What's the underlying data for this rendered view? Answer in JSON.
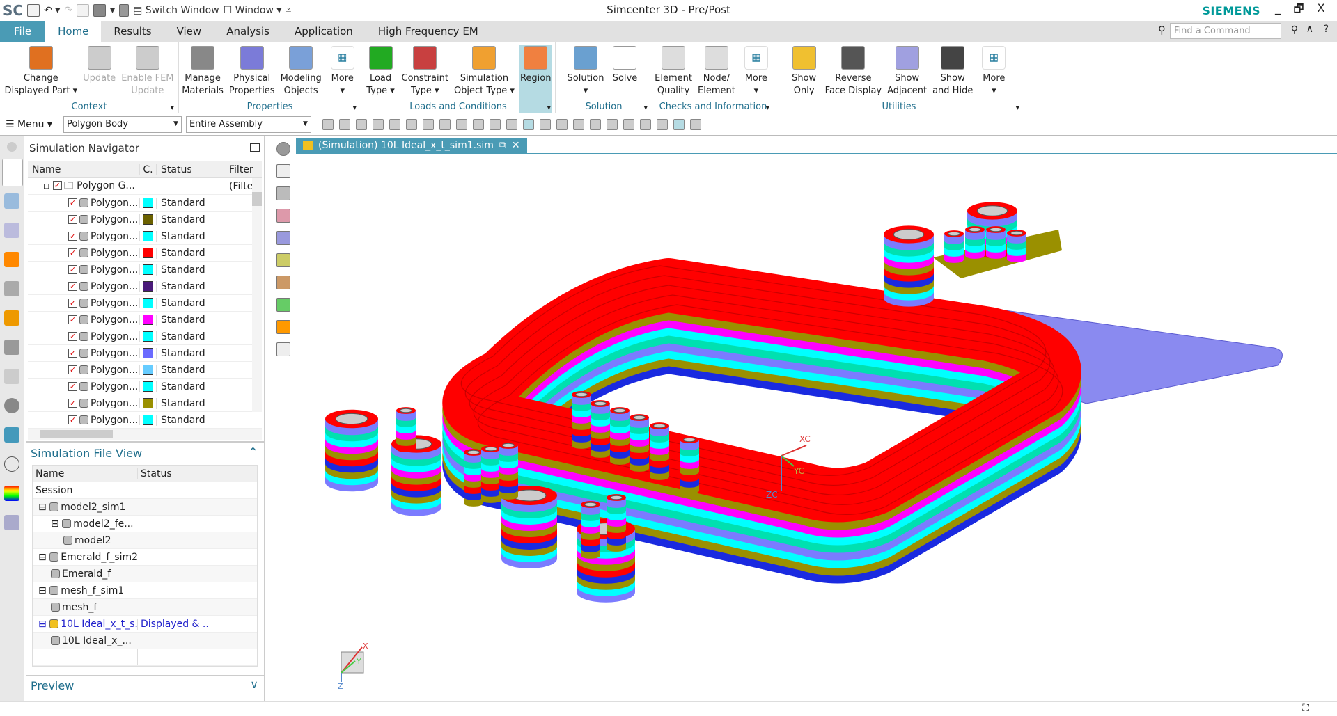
{
  "app": {
    "logo": "SC",
    "title": "Simcenter 3D - Pre/Post",
    "brand": "SIEMENS",
    "accent": "#4a9bb5"
  },
  "qat": {
    "switch_window": "Switch Window",
    "window": "Window"
  },
  "window_controls": {
    "minimize": "_",
    "restore": "🗗",
    "close": "X"
  },
  "tabs": [
    "File",
    "Home",
    "Results",
    "View",
    "Analysis",
    "Application",
    "High Frequency EM"
  ],
  "active_tab": "Home",
  "search": {
    "placeholder": "Find a Command"
  },
  "ribbon": [
    {
      "label": "Context",
      "w": 257,
      "buttons": [
        {
          "l1": "Change",
          "l2": "Displayed Part ▾",
          "icon": "change-displayed-part",
          "color": "#e07020"
        },
        {
          "l1": "Update",
          "l2": "",
          "icon": "update",
          "dis": true,
          "color": "#ccc"
        },
        {
          "l1": "Enable FEM",
          "l2": "Update",
          "icon": "enable-fem-update",
          "dis": true,
          "color": "#ccc"
        }
      ]
    },
    {
      "label": "Properties",
      "w": 262,
      "buttons": [
        {
          "l1": "Manage",
          "l2": "Materials",
          "icon": "manage-materials",
          "color": "#888"
        },
        {
          "l1": "Physical",
          "l2": "Properties",
          "icon": "physical-properties",
          "color": "#7b7bd8"
        },
        {
          "l1": "Modeling",
          "l2": "Objects",
          "icon": "modeling-objects",
          "color": "#7aa0d8"
        },
        {
          "l1": "More",
          "l2": "▾",
          "icon": "more",
          "more": true
        }
      ]
    },
    {
      "label": "Loads and Conditions",
      "w": 279,
      "buttons": [
        {
          "l1": "Load",
          "l2": "Type ▾",
          "icon": "load-type",
          "color": "#22aa22"
        },
        {
          "l1": "Constraint",
          "l2": "Type ▾",
          "icon": "constraint-type",
          "color": "#c84040"
        },
        {
          "l1": "Simulation",
          "l2": "Object Type ▾",
          "icon": "simulation-object-type",
          "color": "#f0a030"
        },
        {
          "l1": "Region",
          "l2": "",
          "icon": "region",
          "hl": true,
          "color": "#f08040"
        }
      ]
    },
    {
      "label": "Solution",
      "w": 139,
      "buttons": [
        {
          "l1": "Solution",
          "l2": "▾",
          "icon": "solution",
          "color": "#6aa0d0"
        },
        {
          "l1": "Solve",
          "l2": "",
          "icon": "solve",
          "color": "#fff"
        }
      ]
    },
    {
      "label": "Checks and Information",
      "w": 175,
      "buttons": [
        {
          "l1": "Element",
          "l2": "Quality",
          "icon": "element-quality",
          "color": "#ddd"
        },
        {
          "l1": "Node/",
          "l2": "Element",
          "icon": "node-element",
          "color": "#ddd"
        },
        {
          "l1": "More",
          "l2": "▾",
          "icon": "more",
          "more": true
        }
      ]
    },
    {
      "label": "Utilities",
      "w": 359,
      "buttons": [
        {
          "l1": "Show",
          "l2": "Only",
          "icon": "show-only",
          "color": "#f0c030"
        },
        {
          "l1": "Reverse",
          "l2": "Face Display",
          "icon": "reverse-face-display",
          "color": "#555"
        },
        {
          "l1": "Show",
          "l2": "Adjacent",
          "icon": "show-adjacent",
          "color": "#a0a0e0"
        },
        {
          "l1": "Show",
          "l2": "and Hide",
          "icon": "show-and-hide",
          "color": "#444"
        },
        {
          "l1": "More",
          "l2": "▾",
          "icon": "more",
          "more": true
        }
      ]
    }
  ],
  "toolbar": {
    "menu": "Menu",
    "filter": "Polygon Body",
    "scope": "Entire Assembly"
  },
  "navigator": {
    "title": "Simulation Navigator",
    "columns": [
      "Name",
      "C.",
      "Status",
      "Filter"
    ],
    "root": {
      "name": "Polygon G...",
      "filter": "(Filte"
    },
    "rows": [
      {
        "name": "Polygon...",
        "color": "#00ffff",
        "status": "Standard"
      },
      {
        "name": "Polygon...",
        "color": "#6b6100",
        "status": "Standard"
      },
      {
        "name": "Polygon...",
        "color": "#00ffff",
        "status": "Standard"
      },
      {
        "name": "Polygon...",
        "color": "#ff0000",
        "status": "Standard"
      },
      {
        "name": "Polygon...",
        "color": "#00ffff",
        "status": "Standard"
      },
      {
        "name": "Polygon...",
        "color": "#4a1a7a",
        "status": "Standard"
      },
      {
        "name": "Polygon...",
        "color": "#00ffff",
        "status": "Standard"
      },
      {
        "name": "Polygon...",
        "color": "#ff00ff",
        "status": "Standard"
      },
      {
        "name": "Polygon...",
        "color": "#00ffff",
        "status": "Standard"
      },
      {
        "name": "Polygon...",
        "color": "#6b6bff",
        "status": "Standard"
      },
      {
        "name": "Polygon...",
        "color": "#66ccff",
        "status": "Standard"
      },
      {
        "name": "Polygon...",
        "color": "#00ffff",
        "status": "Standard"
      },
      {
        "name": "Polygon...",
        "color": "#9a9000",
        "status": "Standard"
      },
      {
        "name": "Polygon...",
        "color": "#00ffff",
        "status": "Standard"
      }
    ]
  },
  "file_view": {
    "title": "Simulation File View",
    "columns": [
      "Name",
      "Status"
    ],
    "rows": [
      {
        "name": "Session",
        "status": "",
        "indent": 0
      },
      {
        "name": "model2_sim1",
        "status": "",
        "indent": 1,
        "exp": true
      },
      {
        "name": "model2_fe...",
        "status": "",
        "indent": 2,
        "exp": true
      },
      {
        "name": "model2",
        "status": "",
        "indent": 3
      },
      {
        "name": "Emerald_f_sim2",
        "status": "",
        "indent": 1,
        "exp": true
      },
      {
        "name": "Emerald_f",
        "status": "",
        "indent": 2
      },
      {
        "name": "mesh_f_sim1",
        "status": "",
        "indent": 1,
        "exp": true
      },
      {
        "name": "mesh_f",
        "status": "",
        "indent": 2
      },
      {
        "name": "10L Ideal_x_t_s...",
        "status": "Displayed & ...",
        "indent": 1,
        "exp": true,
        "active": true
      },
      {
        "name": "10L Ideal_x_...",
        "status": "",
        "indent": 2
      }
    ]
  },
  "preview": {
    "title": "Preview"
  },
  "graphics": {
    "tab_title": "(Simulation) 10L Ideal_x_t_sim1.sim",
    "wcs": {
      "x": "XC",
      "y": "YC",
      "z": "ZC"
    },
    "triad": {
      "x": "X",
      "y": "Y",
      "z": "Z"
    }
  }
}
